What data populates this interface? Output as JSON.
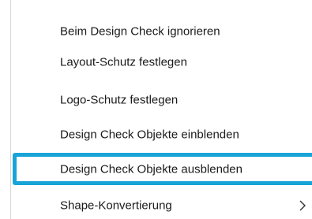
{
  "menu": {
    "items": [
      {
        "label": "Beim Design Check ignorieren"
      },
      {
        "label": "Layout-Schutz festlegen"
      },
      {
        "label": "Logo-Schutz festlegen"
      },
      {
        "label": "Design Check Objekte einblenden"
      },
      {
        "label": "Design Check Objekte ausblenden",
        "highlighted": true
      },
      {
        "label": "Shape-Konvertierung",
        "has_submenu": true,
        "submenu_icon": "chevron-right-icon"
      }
    ]
  },
  "colors": {
    "highlight_border": "#19a4d8",
    "text": "#1a1a1a",
    "background": "#ffffff"
  }
}
